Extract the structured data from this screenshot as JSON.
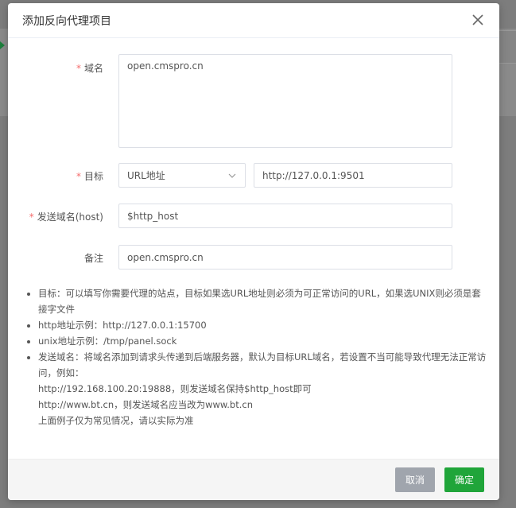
{
  "dialog": {
    "title": "添加反向代理项目",
    "close_icon": "close-icon"
  },
  "form": {
    "domain": {
      "label": "域名",
      "required": "*",
      "value": "open.cmspro.cn"
    },
    "target": {
      "label": "目标",
      "required": "*",
      "type_selected": "URL地址",
      "url_value": "http://127.0.0.1:9501"
    },
    "send_host": {
      "label": "发送域名(host)",
      "required": "*",
      "value": "$http_host"
    },
    "remark": {
      "label": "备注",
      "value": "open.cmspro.cn"
    }
  },
  "notes": [
    {
      "text": "目标：可以填写你需要代理的站点，目标如果选URL地址则必须为可正常访问的URL，如果选UNIX则必须是套接字文件"
    },
    {
      "text": "http地址示例：http://127.0.0.1:15700"
    },
    {
      "text": "unix地址示例：/tmp/panel.sock"
    },
    {
      "text": "发送域名：将域名添加到请求头传递到后端服务器，默认为目标URL域名，若设置不当可能导致代理无法正常访问，例如：",
      "lines": [
        "http://192.168.100.20:19888，则发送域名保持$http_host即可",
        "http://www.bt.cn，则发送域名应当改为www.bt.cn",
        "上面例子仅为常见情况，请以实际为准"
      ]
    }
  ],
  "footer": {
    "cancel_label": "取消",
    "ok_label": "确定"
  },
  "colors": {
    "primary": "#20a53a",
    "cancel": "#a0a5ad",
    "required": "#f56c6c"
  }
}
